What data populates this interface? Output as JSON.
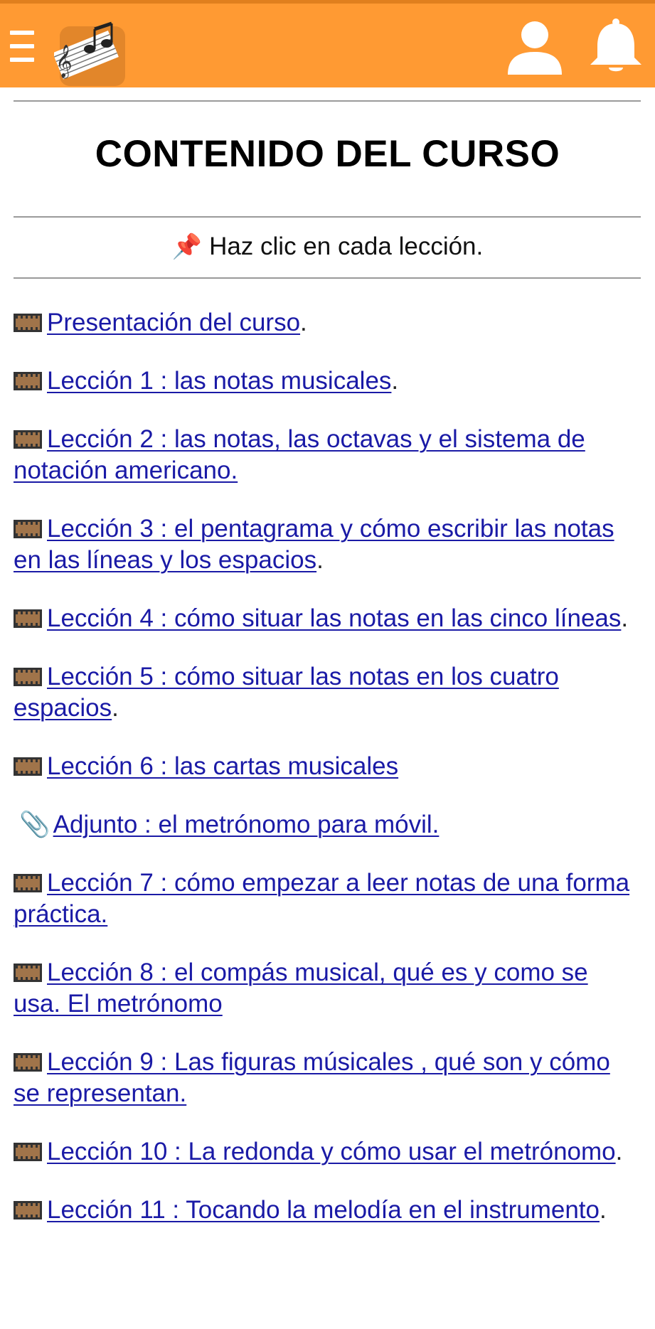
{
  "header": {
    "menu_icon": "hamburger-menu-icon",
    "logo_icon": "music-notes-logo",
    "user_icon": "user-icon",
    "bell_icon": "bell-icon",
    "bar_color": "#FF9A33"
  },
  "page": {
    "title": "CONTENIDO DEL CURSO",
    "hint_icon": "📌",
    "hint": "Haz clic en cada lección."
  },
  "lessons": [
    {
      "icon": "film",
      "link": "Presentación del curso",
      "after": "."
    },
    {
      "icon": "film",
      "link": "Lección 1 : las notas musicales",
      "after": "."
    },
    {
      "icon": "film",
      "link": "Lección 2 : las notas, las octavas y el sistema de notación americano.",
      "after": ""
    },
    {
      "icon": "film",
      "link": "Lección 3 : el pentagrama y cómo escribir las notas en las líneas y los espacios",
      "after": "."
    },
    {
      "icon": "film",
      "link": "Lección 4 : cómo situar las notas en las cinco líneas",
      "after": "."
    },
    {
      "icon": "film",
      "link": "Lección 5 : cómo situar las notas en los cuatro espacios",
      "after": "."
    },
    {
      "icon": "film",
      "link": "Lección 6 : las cartas musicales",
      "after": ""
    },
    {
      "icon": "paperclip",
      "link": "Adjunto : el metrónomo para móvil.",
      "after": ""
    },
    {
      "icon": "film",
      "link": "Lección 7 : cómo empezar a leer notas de una forma práctica.",
      "after": ""
    },
    {
      "icon": "film",
      "link": "Lección 8 : el compás musical, qué es y como se usa. El metrónomo",
      "after": ""
    },
    {
      "icon": "film",
      "link": "Lección 9 : Las figuras músicales , qué son y cómo se representan.",
      "after": ""
    },
    {
      "icon": "film",
      "link": "Lección 10 : La redonda y cómo usar el metrónomo",
      "after": "."
    },
    {
      "icon": "film",
      "link": "Lección 11 : Tocando la melodía en el instrumento",
      "after": "."
    }
  ]
}
